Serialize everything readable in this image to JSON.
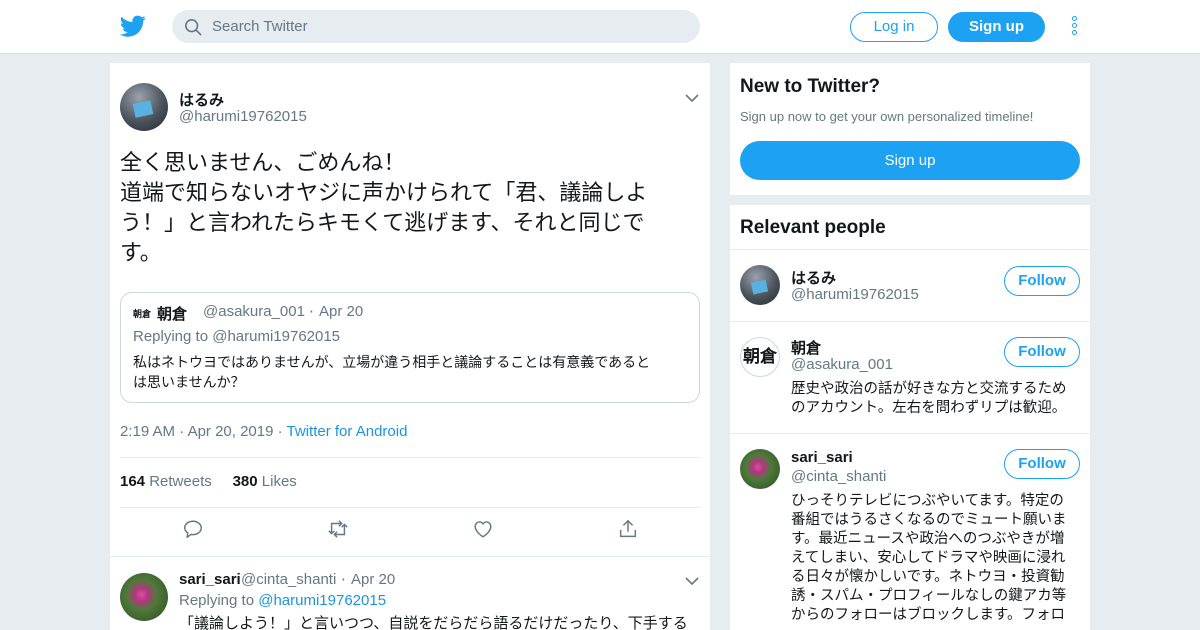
{
  "header": {
    "logo_icon": "twitter-bird-icon",
    "search_placeholder": "Search Twitter",
    "login_label": "Log in",
    "signup_label": "Sign up",
    "more_icon": "more-vertical-icon",
    "accent_color": "#1da1f2"
  },
  "tweet": {
    "author_name": "はるみ",
    "author_handle": "@harumi19762015",
    "text_lines": [
      "全く思いません、ごめんね！",
      "道端で知らないオヤジに声かけられて「君、議論しよ",
      "う！」と言われたらキモくて逃げます、それと同じで",
      "す。"
    ],
    "quoted": {
      "avatar_text": "朝倉",
      "name": "朝倉",
      "handle": "@asakura_001",
      "dot": "·",
      "date": "Apr 20",
      "replying_to": "Replying to @harumi19762015",
      "text_lines": [
        "私はネトウヨではありませんが、立場が違う相手と議論することは有意義であると",
        "は思いませんか？"
      ]
    },
    "time": "2:19 AM",
    "date": "Apr 20, 2019",
    "dot": "·",
    "source": "Twitter for Android",
    "retweets_count": "164",
    "retweets_label": "Retweets",
    "likes_count": "380",
    "likes_label": "Likes",
    "actions": [
      "reply-icon",
      "retweet-icon",
      "like-icon",
      "share-icon"
    ]
  },
  "reply": {
    "name": "sari_sari",
    "handle": "@cinta_shanti",
    "dot": "·",
    "date": "Apr 20",
    "replying_prefix": "Replying to ",
    "replying_handle": "@harumi19762015",
    "text": "「議論しよう！」と言いつつ、自説をだらだら語るだけだったり、下手する"
  },
  "sidebar": {
    "new_title": "New to Twitter?",
    "new_sub": "Sign up now to get your own personalized timeline!",
    "new_signup": "Sign up",
    "relevant_title": "Relevant people",
    "people": [
      {
        "name": "はるみ",
        "handle": "@harumi19762015",
        "follow": "Follow",
        "bio_lines": []
      },
      {
        "name": "朝倉",
        "handle": "@asakura_001",
        "follow": "Follow",
        "avatar_text": "朝倉",
        "bio_lines": [
          "歴史や政治の話が好きな方と交流するため",
          "のアカウント。左右を問わずリプは歓迎。"
        ]
      },
      {
        "name": "sari_sari",
        "handle": "@cinta_shanti",
        "follow": "Follow",
        "bio_lines": [
          "ひっそりテレビにつぶやいてます。特定の",
          "番組ではうるさくなるのでミュート願いま",
          "す。最近ニュースや政治へのつぶやきが増",
          "えてしまい、安心してドラマや映画に浸れ",
          "る日々が懐かしいです。ネトウヨ・投資勧",
          "誘・スパム・プロフィールなしの鍵アカ等",
          "からのフォローはブロックします。フォロ"
        ]
      }
    ]
  }
}
